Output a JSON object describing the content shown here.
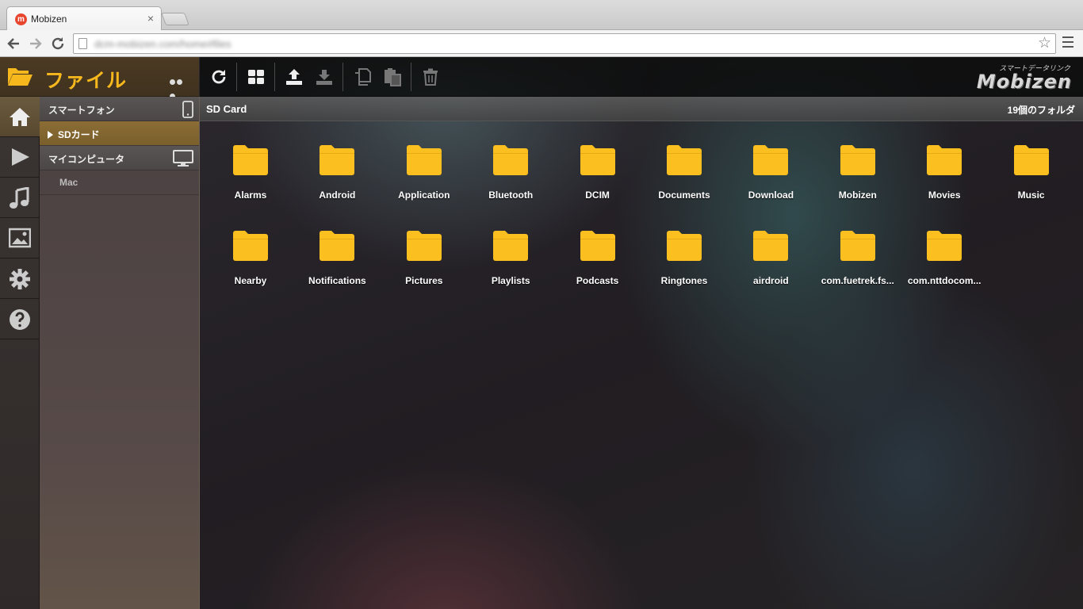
{
  "browser": {
    "tab_title": "Mobizen",
    "tab_favicon": "m",
    "tab_close": "×",
    "url": "dcm-mobizen.com/home#files"
  },
  "sidebar": {
    "title": "ファイル",
    "icons": [
      "home-icon",
      "play-icon",
      "music-icon",
      "image-icon",
      "gear-icon",
      "help-icon"
    ],
    "tree": {
      "smartphone_label": "スマートフォン",
      "sdcard_label": "SDカード",
      "computer_label": "マイコンピュータ",
      "mac_label": "Mac"
    }
  },
  "toolbar": {
    "buttons": [
      "refresh-icon",
      "grid-view-icon",
      "upload-icon",
      "download-icon",
      "copy-icon",
      "paste-icon",
      "trash-icon"
    ],
    "brand_sub": "スマートデータリンク",
    "brand_logo": "Mobizen"
  },
  "path": {
    "title": "SD Card",
    "count": "19個のフォルダ"
  },
  "colors": {
    "accent": "#f6b81c",
    "folder": "#fbbf1f"
  },
  "folders": [
    "Alarms",
    "Android",
    "Application",
    "Bluetooth",
    "DCIM",
    "Documents",
    "Download",
    "Mobizen",
    "Movies",
    "Music",
    "Nearby",
    "Notifications",
    "Pictures",
    "Playlists",
    "Podcasts",
    "Ringtones",
    "airdroid",
    "com.fuetrek.fs...",
    "com.nttdocom..."
  ]
}
